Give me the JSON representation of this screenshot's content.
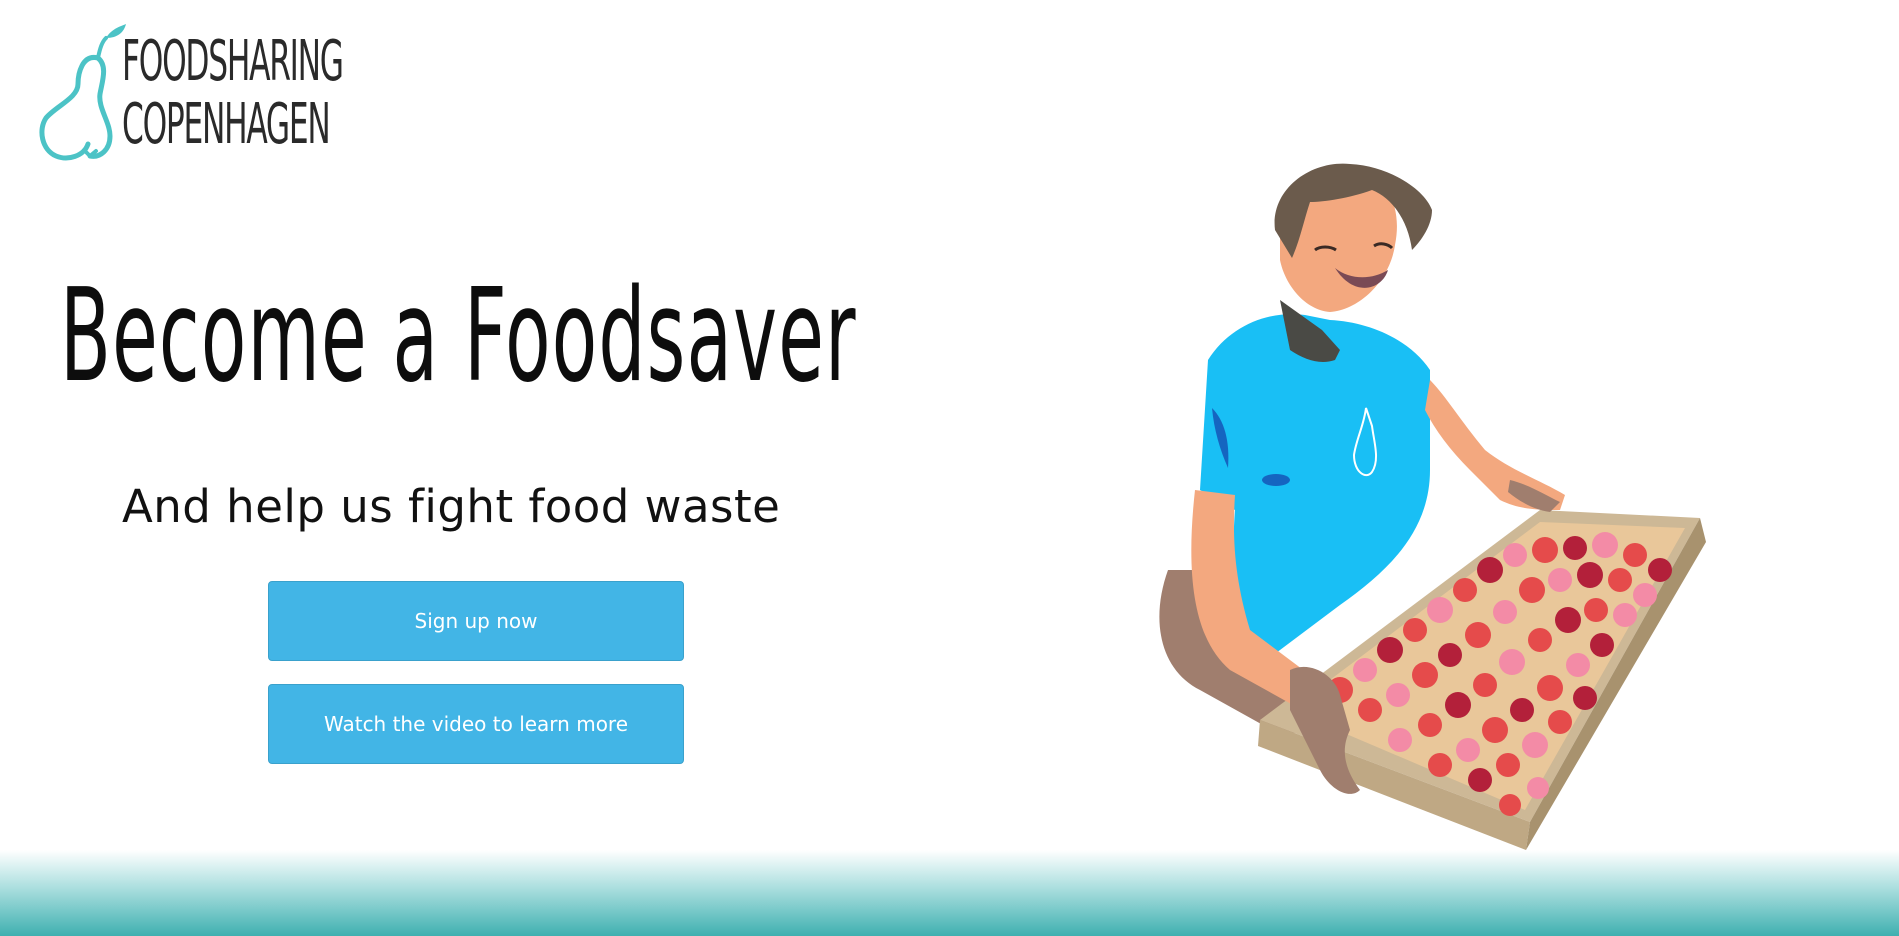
{
  "brand": {
    "line1": "FOODSHARING",
    "line2": "COPENHAGEN",
    "logo_icon": "pear-icon",
    "accent_color": "#4cc3c6"
  },
  "hero": {
    "headline": "Become a Foodsaver",
    "subline": "And help us fight food waste"
  },
  "buttons": {
    "signup_label": "Sign up now",
    "video_label": "Watch the video to learn more",
    "color": "#42b5e6"
  },
  "illustration": {
    "icon": "volunteer-with-strawberry-tray-illustration",
    "shirt_color": "#19bff5"
  }
}
